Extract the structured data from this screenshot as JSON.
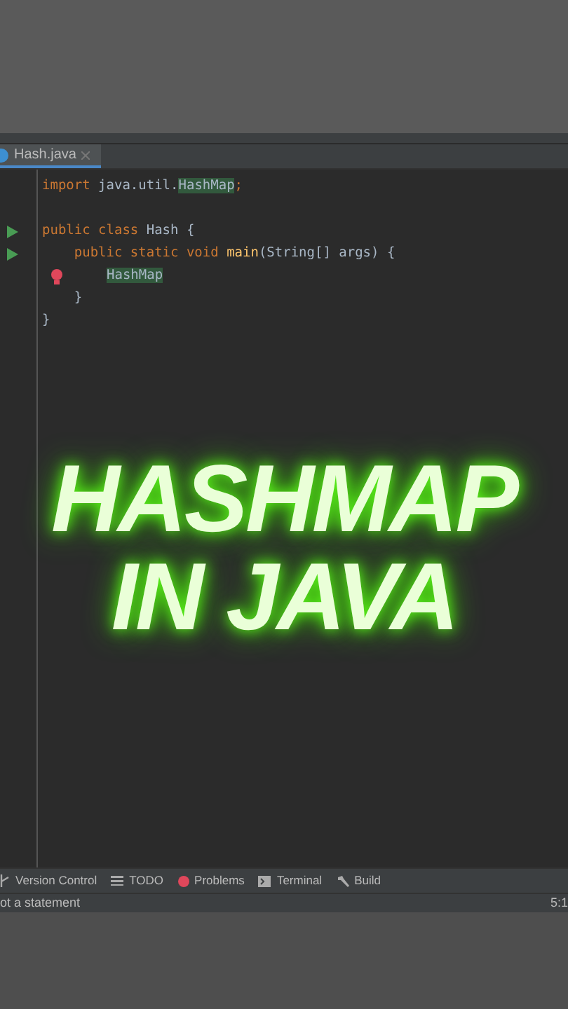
{
  "editor_tab": {
    "label": "Hash.java",
    "selected": true
  },
  "code_lines": [
    {
      "kind": "plain",
      "tokens": [
        {
          "kind": "keyword",
          "text": "import"
        },
        {
          "kind": "plain",
          "text": " java.util."
        },
        {
          "kind": "match",
          "text": "HashMap"
        },
        {
          "kind": "keyword",
          "text": ";"
        }
      ]
    },
    {
      "kind": "plain"
    },
    {
      "kind": "runnable",
      "tokens": [
        {
          "kind": "keyword",
          "text": "public class"
        },
        {
          "kind": "plain",
          "text": " Hash {"
        }
      ]
    },
    {
      "kind": "runnable",
      "tokens": [
        {
          "kind": "keyword",
          "text": "    public static void"
        },
        {
          "kind": "method",
          "text": " main"
        },
        {
          "kind": "plain",
          "text": "(String[] args) {"
        }
      ]
    },
    {
      "kind": "error",
      "tokens": [
        {
          "kind": "match",
          "text": "HashMap"
        }
      ]
    },
    {
      "kind": "plain",
      "tokens": [
        {
          "kind": "plain",
          "text": "    }"
        }
      ]
    },
    {
      "kind": "plain",
      "tokens": [
        {
          "kind": "plain",
          "text": "}"
        }
      ]
    }
  ],
  "overlay_title": [
    "HASHMAP",
    "IN JAVA"
  ],
  "tool_windows": [
    {
      "kind": "vcs",
      "label": "Version Control"
    },
    {
      "kind": "todo",
      "label": "TODO"
    },
    {
      "kind": "problems",
      "label": "Problems"
    },
    {
      "kind": "terminal",
      "label": "Terminal"
    },
    {
      "kind": "build",
      "label": "Build"
    }
  ],
  "status_bar": {
    "message": "ot a statement",
    "position": "5:1"
  }
}
